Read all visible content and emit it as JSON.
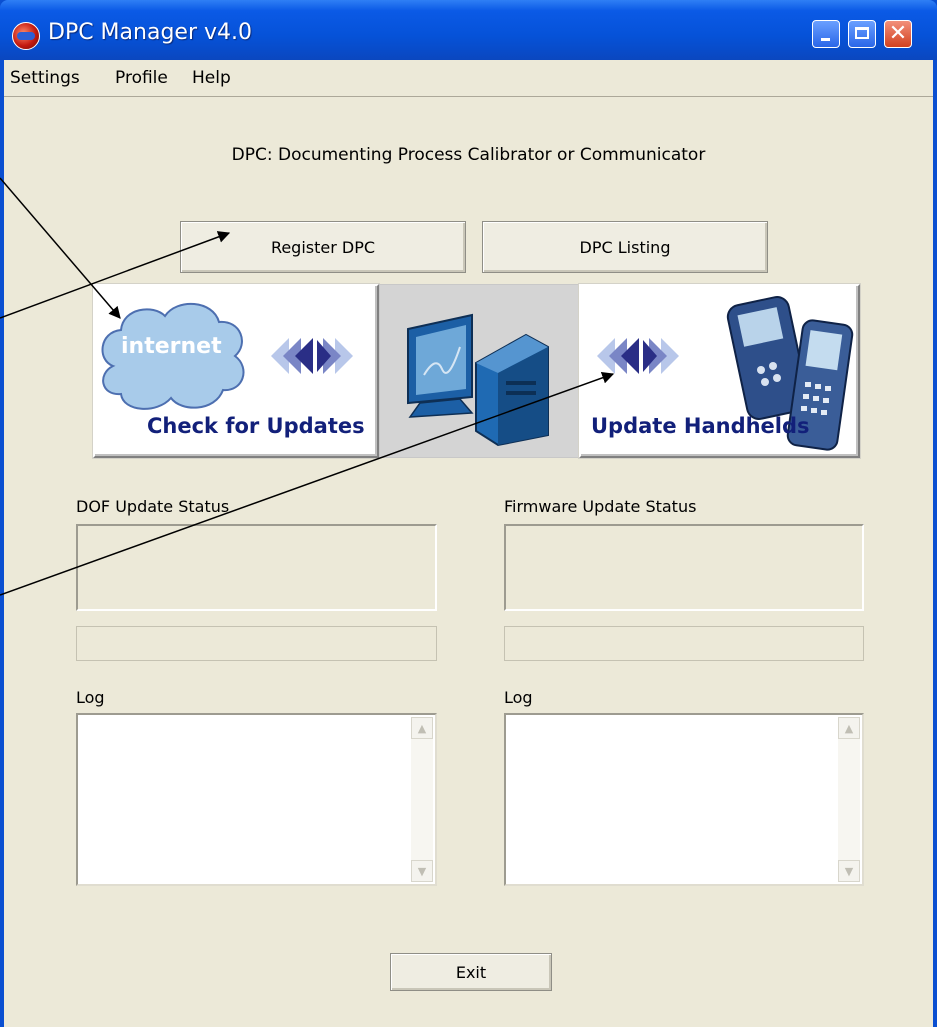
{
  "window": {
    "title": "DPC Manager v4.0",
    "icon": "app-globe-icon"
  },
  "menubar": {
    "items": [
      "Settings",
      "Profile",
      "Help"
    ]
  },
  "header": {
    "subtitle": "DPC: Documenting Process Calibrator or Communicator"
  },
  "buttons": {
    "register": "Register DPC",
    "listing": "DPC Listing",
    "exit": "Exit"
  },
  "image_buttons": {
    "check_updates": "Check for Updates",
    "cloud_text": "internet",
    "update_handhelds": "Update Handhelds"
  },
  "status": {
    "dof_label": "DOF Update Status",
    "firmware_label": "Firmware Update Status"
  },
  "logs": {
    "left_label": "Log",
    "right_label": "Log"
  },
  "colors": {
    "titlebar": "#0652d8",
    "dialog_bg": "#ece9d8",
    "image_text": "#12207a",
    "cloud": "#9fc6e8"
  }
}
